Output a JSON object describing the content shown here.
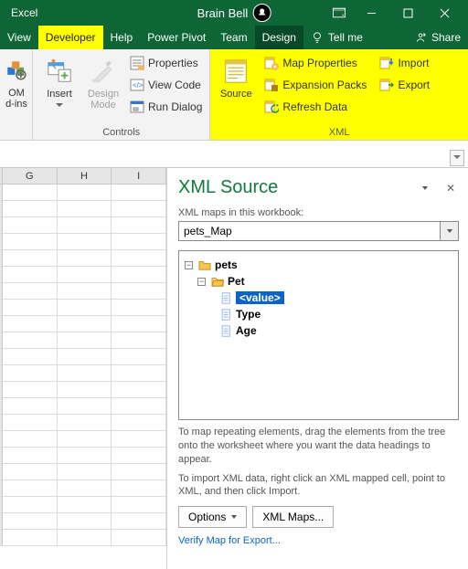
{
  "title": {
    "app": "Excel",
    "user": "Brain Bell"
  },
  "tabs": {
    "view": "View",
    "developer": "Developer",
    "help": "Help",
    "powerpivot": "Power Pivot",
    "team": "Team",
    "design": "Design",
    "tellme": "Tell me",
    "share": "Share"
  },
  "ribbon": {
    "addins": {
      "line1": "OM",
      "line2": "d-ins"
    },
    "insert": "Insert",
    "designmode": {
      "line1": "Design",
      "line2": "Mode"
    },
    "controls": {
      "properties": "Properties",
      "viewcode": "View Code",
      "rundialog": "Run Dialog",
      "group": "Controls"
    },
    "xml": {
      "source": "Source",
      "mapprops": "Map Properties",
      "expansion": "Expansion Packs",
      "refresh": "Refresh Data",
      "import": "Import",
      "export": "Export",
      "group": "XML"
    }
  },
  "sheet": {
    "cols": [
      "G",
      "H",
      "I"
    ]
  },
  "pane": {
    "title": "XML Source",
    "mapslabel": "XML maps in this workbook:",
    "selected_map": "pets_Map",
    "tree": {
      "root": "pets",
      "child": "Pet",
      "items": [
        "<value>",
        "Type",
        "Age"
      ]
    },
    "hint1": "To map repeating elements, drag the elements from the tree onto the worksheet where you want the data headings to appear.",
    "hint2": "To import XML data, right click an XML mapped cell, point to XML, and then click Import.",
    "options_btn": "Options",
    "xmlmaps_btn": "XML Maps...",
    "verify": "Verify Map for Export..."
  }
}
